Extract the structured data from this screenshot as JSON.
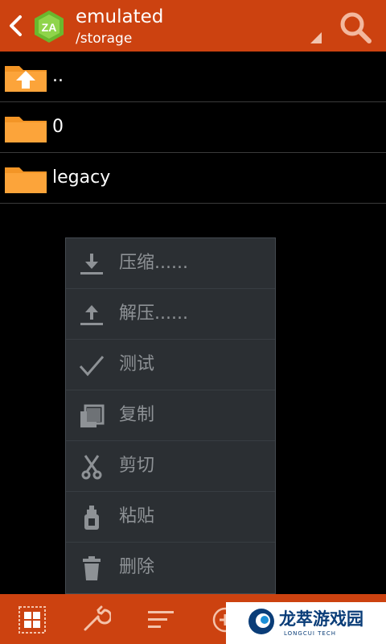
{
  "header": {
    "title": "emulated",
    "path": "/storage",
    "back_icon": "back-arrow-icon",
    "logo_icon": "zarchiver-logo-icon",
    "search_icon": "search-icon",
    "bar_color": "#cc4210"
  },
  "files": [
    {
      "name": "..",
      "icon": "folder-up-icon"
    },
    {
      "name": "0",
      "icon": "folder-icon"
    },
    {
      "name": "legacy",
      "icon": "folder-icon"
    }
  ],
  "context_menu": {
    "items": [
      {
        "label": "压缩......",
        "icon": "compress-icon"
      },
      {
        "label": "解压......",
        "icon": "extract-icon"
      },
      {
        "label": "测试",
        "icon": "check-icon"
      },
      {
        "label": "复制",
        "icon": "copy-icon"
      },
      {
        "label": "剪切",
        "icon": "scissors-icon"
      },
      {
        "label": "粘贴",
        "icon": "paste-icon"
      },
      {
        "label": "删除",
        "icon": "trash-icon"
      }
    ]
  },
  "toolbar": {
    "icons": [
      "grid-icon",
      "wrench-icon",
      "sort-icon",
      "add-icon"
    ]
  },
  "watermark": {
    "text": "龙萃游戏园",
    "subtext": "LONGCUI TECH",
    "color": "#0a3d78"
  }
}
